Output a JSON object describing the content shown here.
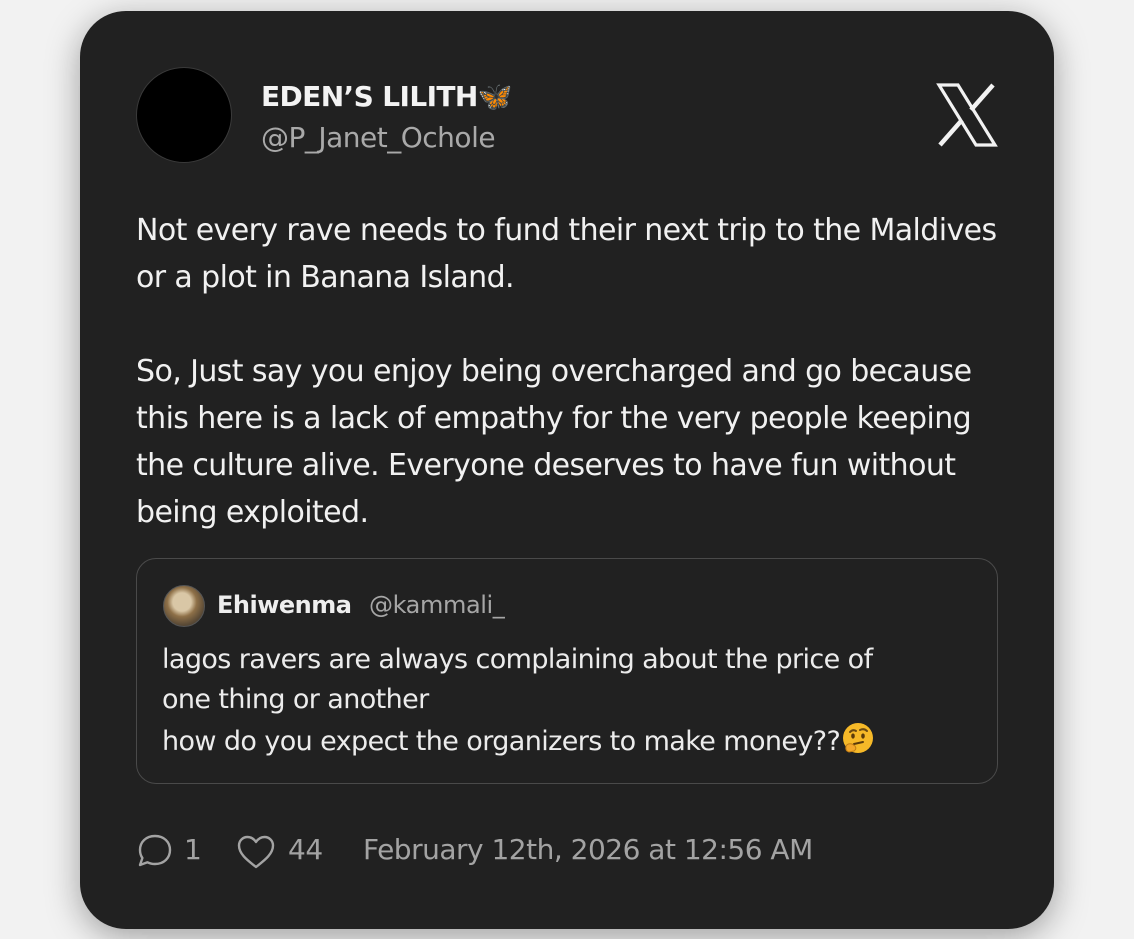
{
  "author": {
    "display_name": "EDEN’S LILITH🦋",
    "handle": "@P_Janet_Ochole"
  },
  "platform_icon": "x-logo-icon",
  "tweet": {
    "paragraphs": [
      "Not every rave needs to fund their next trip to the Maldives or a plot in Banana Island.",
      "So, Just say you enjoy being overcharged and go because this here  is a lack of empathy for the very people keeping the culture alive. Everyone deserves to have fun without being exploited."
    ]
  },
  "quoted_tweet": {
    "name": "Ehiwenma",
    "handle": "@kammali_",
    "lines": [
      "lagos ravers are always complaining about the price of",
      "one thing or another",
      "how do you expect the organizers to make money??"
    ],
    "emoji_icon": "thinking-face-icon"
  },
  "stats": {
    "replies": "1",
    "likes": "44",
    "timestamp": "February 12th, 2026 at 12:56 AM"
  },
  "colors": {
    "card_background": "#212121",
    "page_background": "#f2f2f2",
    "primary_text": "#f1f1f1",
    "secondary_text": "#a3a3a3"
  }
}
